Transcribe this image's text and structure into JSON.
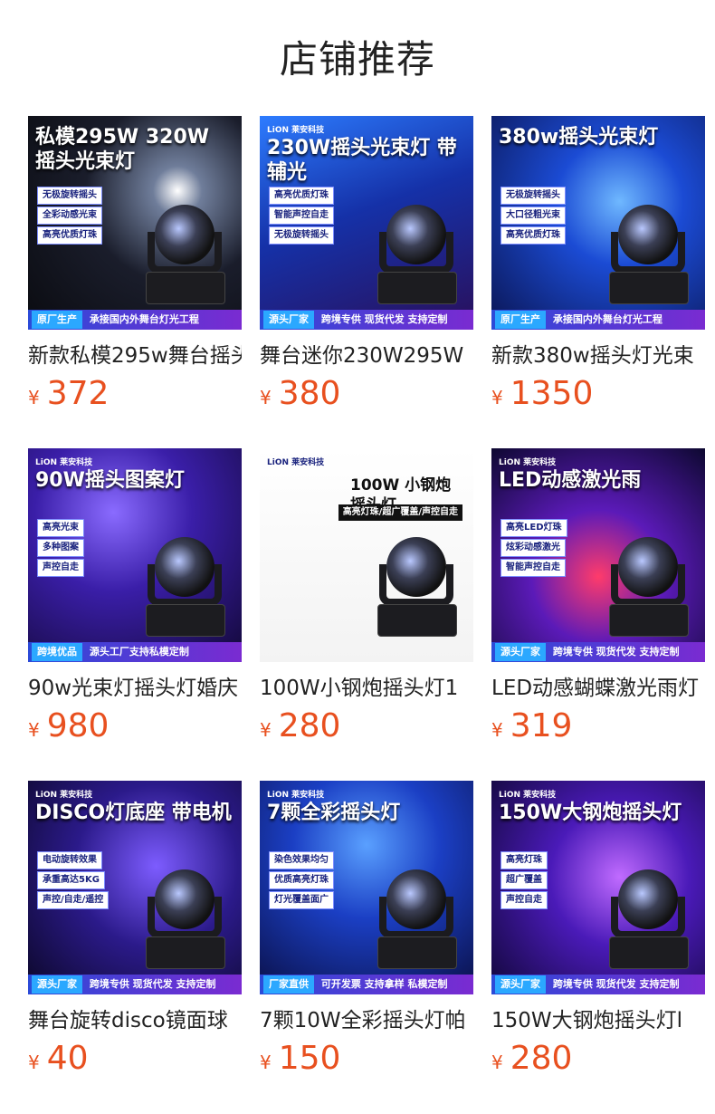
{
  "page": {
    "title": "店铺推荐"
  },
  "products": [
    {
      "name": "新款私模295w舞台摇头",
      "currency": "¥",
      "price": "372",
      "image": {
        "headline": "私模295W 320W 摇头光束灯",
        "tags": [
          "无极旋转摇头",
          "全彩动感光束",
          "高亮优质灯珠"
        ],
        "badge": "原厂生产",
        "footer": "承接国内外舞台灯光工程",
        "logo": ""
      }
    },
    {
      "name": "舞台迷你230W295W",
      "currency": "¥",
      "price": "380",
      "image": {
        "headline": "230W摇头光束灯 带辅光",
        "tags": [
          "高亮优质灯珠",
          "智能声控自走",
          "无极旋转摇头"
        ],
        "badge": "源头厂家",
        "footer": "跨境专供 现货代发 支持定制",
        "logo": "LiON 莱安科技"
      }
    },
    {
      "name": "新款380w摇头灯光束",
      "currency": "¥",
      "price": "1350",
      "image": {
        "headline": "380w摇头光束灯",
        "tags": [
          "无极旋转摇头",
          "大口径粗光束",
          "高亮优质灯珠"
        ],
        "badge": "原厂生产",
        "footer": "承接国内外舞台灯光工程",
        "logo": ""
      }
    },
    {
      "name": "90w光束灯摇头灯婚庆",
      "currency": "¥",
      "price": "980",
      "image": {
        "headline": "90W摇头图案灯",
        "tags": [
          "高亮光束",
          "多种图案",
          "声控自走"
        ],
        "badge": "跨境优品",
        "footer": "源头工厂支持私模定制",
        "logo": "LiON 莱安科技"
      }
    },
    {
      "name": "100W小钢炮摇头灯1",
      "currency": "¥",
      "price": "280",
      "image": {
        "headline": "100W 小钢炮摇头灯",
        "tags": [
          "高亮灯珠/超广覆盖/声控自走"
        ],
        "badge": "",
        "footer": "",
        "logo": "LiON 莱安科技"
      }
    },
    {
      "name": "LED动感蝴蝶激光雨灯",
      "currency": "¥",
      "price": "319",
      "image": {
        "headline": "LED动感激光雨",
        "tags": [
          "高亮LED灯珠",
          "炫彩动感激光",
          "智能声控自走"
        ],
        "badge": "源头厂家",
        "footer": "跨境专供 现货代发 支持定制",
        "logo": "LiON 莱安科技"
      }
    },
    {
      "name": "舞台旋转disco镜面球",
      "currency": "¥",
      "price": "40",
      "image": {
        "headline": "DISCO灯底座 带电机",
        "tags": [
          "电动旋转效果",
          "承重高达5KG",
          "声控/自走/遥控"
        ],
        "badge": "源头厂家",
        "footer": "跨境专供 现货代发 支持定制",
        "logo": "LiON 莱安科技"
      }
    },
    {
      "name": "7颗10W全彩摇头灯帕",
      "currency": "¥",
      "price": "150",
      "image": {
        "headline": "7颗全彩摇头灯",
        "tags": [
          "染色效果均匀",
          "优质高亮灯珠",
          "灯光覆盖面广"
        ],
        "badge": "厂家直供",
        "footer": "可开发票 支持拿样 私模定制",
        "logo": "LiON 莱安科技"
      }
    },
    {
      "name": "150W大钢炮摇头灯l",
      "currency": "¥",
      "price": "280",
      "image": {
        "headline": "150W大钢炮摇头灯",
        "tags": [
          "高亮灯珠",
          "超广覆盖",
          "声控自走"
        ],
        "badge": "源头厂家",
        "footer": "跨境专供 现货代发 支持定制",
        "logo": "LiON 莱安科技"
      }
    }
  ],
  "colors": {
    "price": "#e8501f",
    "title": "#222222"
  }
}
